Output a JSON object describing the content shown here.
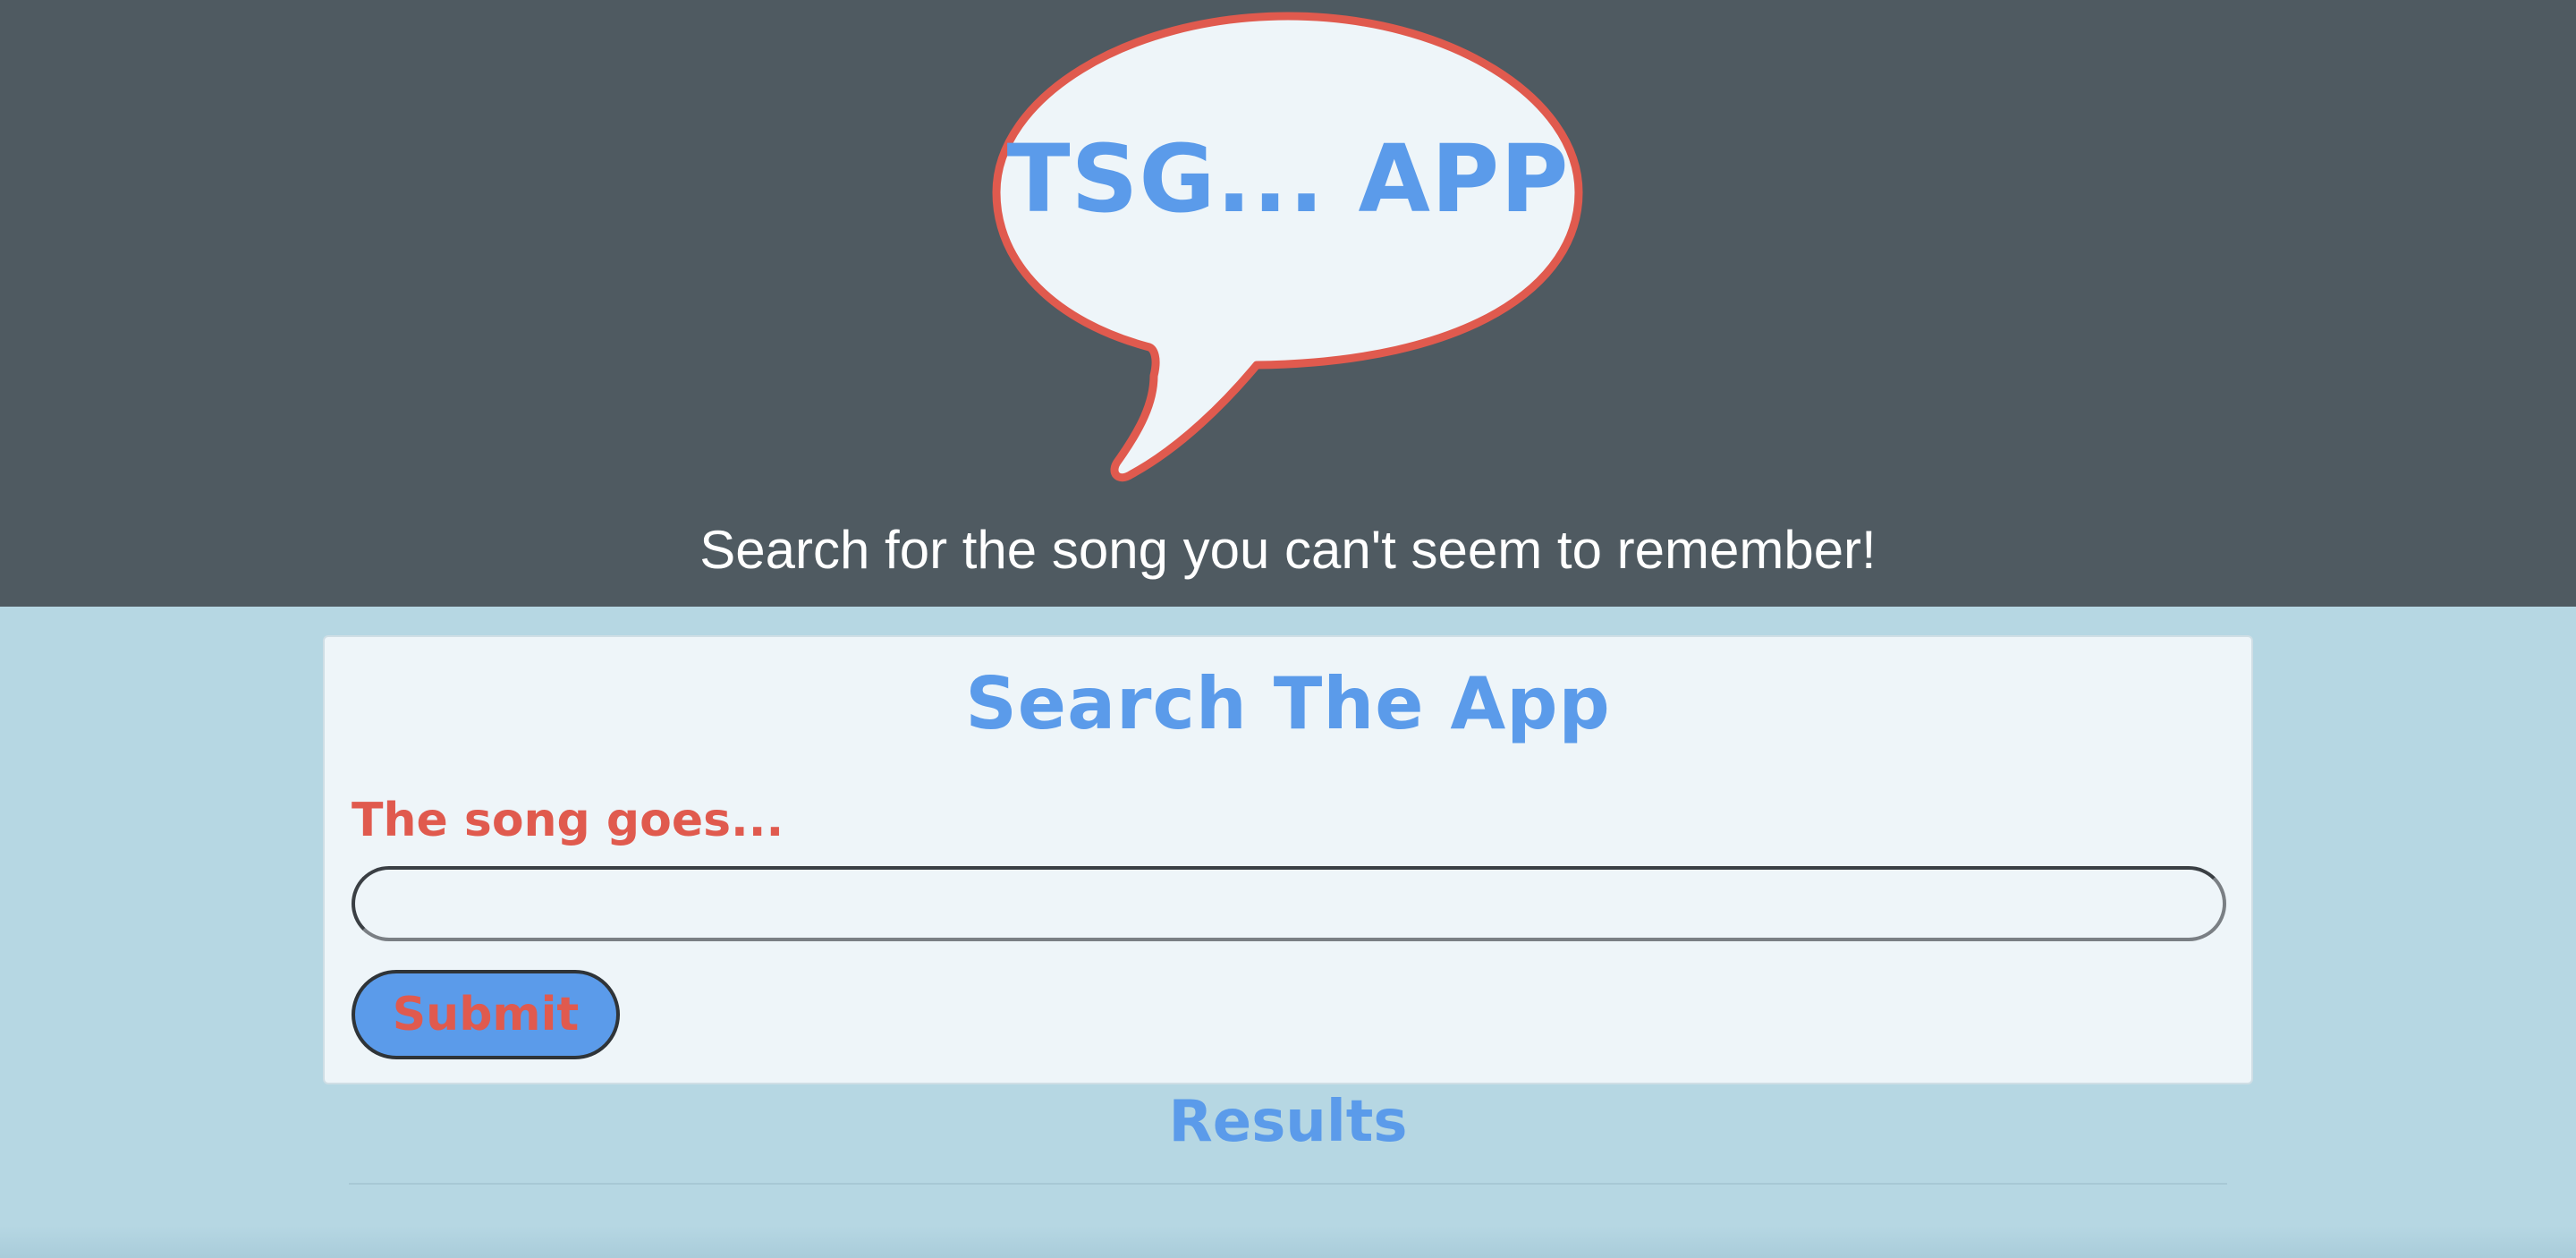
{
  "header": {
    "logo_text": "TSG... APP",
    "tagline": "Search for the song you can't seem to remember!"
  },
  "search_card": {
    "title": "Search The App",
    "field_label": "The song goes...",
    "input_value": "",
    "input_placeholder": "",
    "submit_label": "Submit"
  },
  "results": {
    "title": "Results",
    "items": []
  },
  "colors": {
    "header_bg": "#4f5a61",
    "page_bg": "#b6d7e3",
    "card_bg": "#eef5f9",
    "accent_blue": "#5b9bea",
    "accent_red": "#e05a4e"
  },
  "icons": {
    "logo": "speech-bubble-icon"
  }
}
